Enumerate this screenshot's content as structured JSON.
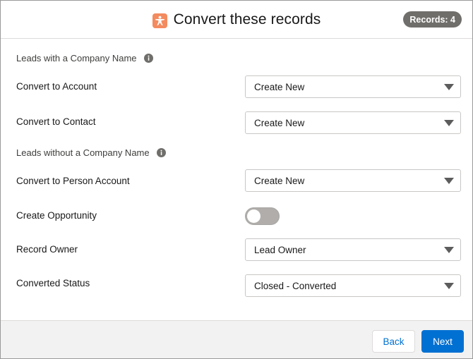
{
  "header": {
    "title": "Convert these records",
    "records_badge": "Records: 4"
  },
  "sections": {
    "with_company": "Leads with a Company Name",
    "without_company": "Leads without a Company Name"
  },
  "rows": {
    "convert_account": {
      "label": "Convert to Account",
      "value": "Create New"
    },
    "convert_contact": {
      "label": "Convert to Contact",
      "value": "Create New"
    },
    "convert_person_account": {
      "label": "Convert to Person Account",
      "value": "Create New"
    },
    "create_opportunity": {
      "label": "Create Opportunity",
      "enabled": false
    },
    "record_owner": {
      "label": "Record Owner",
      "value": "Lead Owner"
    },
    "converted_status": {
      "label": "Converted Status",
      "value": "Closed - Converted"
    }
  },
  "footer": {
    "back_label": "Back",
    "next_label": "Next"
  },
  "colors": {
    "brand_icon": "#f38b5f",
    "primary_button": "#0070d2",
    "badge": "#706e6b"
  }
}
